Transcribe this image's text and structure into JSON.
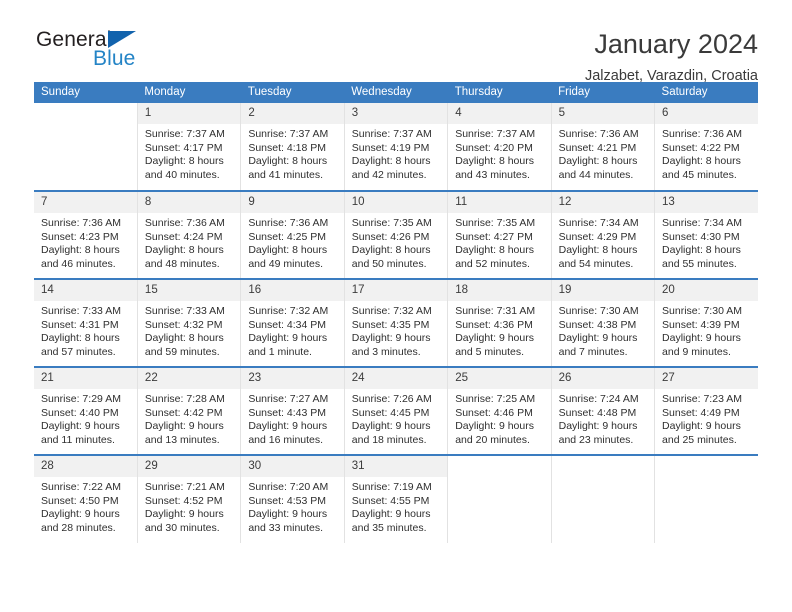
{
  "logo": {
    "text_top": "General",
    "text_bottom": "Blue",
    "triangle_color": "#1263ad",
    "blue_color": "#2484c6"
  },
  "header": {
    "title": "January 2024",
    "subtitle": "Jalzabet, Varazdin, Croatia"
  },
  "calendar": {
    "header_bg": "#3a7cc0",
    "daynum_bg": "#f1f1f1",
    "weekday_headers": [
      "Sunday",
      "Monday",
      "Tuesday",
      "Wednesday",
      "Thursday",
      "Friday",
      "Saturday"
    ],
    "weeks": [
      [
        {
          "day": "",
          "lines": []
        },
        {
          "day": "1",
          "lines": [
            "Sunrise: 7:37 AM",
            "Sunset: 4:17 PM",
            "Daylight: 8 hours",
            "and 40 minutes."
          ]
        },
        {
          "day": "2",
          "lines": [
            "Sunrise: 7:37 AM",
            "Sunset: 4:18 PM",
            "Daylight: 8 hours",
            "and 41 minutes."
          ]
        },
        {
          "day": "3",
          "lines": [
            "Sunrise: 7:37 AM",
            "Sunset: 4:19 PM",
            "Daylight: 8 hours",
            "and 42 minutes."
          ]
        },
        {
          "day": "4",
          "lines": [
            "Sunrise: 7:37 AM",
            "Sunset: 4:20 PM",
            "Daylight: 8 hours",
            "and 43 minutes."
          ]
        },
        {
          "day": "5",
          "lines": [
            "Sunrise: 7:36 AM",
            "Sunset: 4:21 PM",
            "Daylight: 8 hours",
            "and 44 minutes."
          ]
        },
        {
          "day": "6",
          "lines": [
            "Sunrise: 7:36 AM",
            "Sunset: 4:22 PM",
            "Daylight: 8 hours",
            "and 45 minutes."
          ]
        }
      ],
      [
        {
          "day": "7",
          "lines": [
            "Sunrise: 7:36 AM",
            "Sunset: 4:23 PM",
            "Daylight: 8 hours",
            "and 46 minutes."
          ]
        },
        {
          "day": "8",
          "lines": [
            "Sunrise: 7:36 AM",
            "Sunset: 4:24 PM",
            "Daylight: 8 hours",
            "and 48 minutes."
          ]
        },
        {
          "day": "9",
          "lines": [
            "Sunrise: 7:36 AM",
            "Sunset: 4:25 PM",
            "Daylight: 8 hours",
            "and 49 minutes."
          ]
        },
        {
          "day": "10",
          "lines": [
            "Sunrise: 7:35 AM",
            "Sunset: 4:26 PM",
            "Daylight: 8 hours",
            "and 50 minutes."
          ]
        },
        {
          "day": "11",
          "lines": [
            "Sunrise: 7:35 AM",
            "Sunset: 4:27 PM",
            "Daylight: 8 hours",
            "and 52 minutes."
          ]
        },
        {
          "day": "12",
          "lines": [
            "Sunrise: 7:34 AM",
            "Sunset: 4:29 PM",
            "Daylight: 8 hours",
            "and 54 minutes."
          ]
        },
        {
          "day": "13",
          "lines": [
            "Sunrise: 7:34 AM",
            "Sunset: 4:30 PM",
            "Daylight: 8 hours",
            "and 55 minutes."
          ]
        }
      ],
      [
        {
          "day": "14",
          "lines": [
            "Sunrise: 7:33 AM",
            "Sunset: 4:31 PM",
            "Daylight: 8 hours",
            "and 57 minutes."
          ]
        },
        {
          "day": "15",
          "lines": [
            "Sunrise: 7:33 AM",
            "Sunset: 4:32 PM",
            "Daylight: 8 hours",
            "and 59 minutes."
          ]
        },
        {
          "day": "16",
          "lines": [
            "Sunrise: 7:32 AM",
            "Sunset: 4:34 PM",
            "Daylight: 9 hours",
            "and 1 minute."
          ]
        },
        {
          "day": "17",
          "lines": [
            "Sunrise: 7:32 AM",
            "Sunset: 4:35 PM",
            "Daylight: 9 hours",
            "and 3 minutes."
          ]
        },
        {
          "day": "18",
          "lines": [
            "Sunrise: 7:31 AM",
            "Sunset: 4:36 PM",
            "Daylight: 9 hours",
            "and 5 minutes."
          ]
        },
        {
          "day": "19",
          "lines": [
            "Sunrise: 7:30 AM",
            "Sunset: 4:38 PM",
            "Daylight: 9 hours",
            "and 7 minutes."
          ]
        },
        {
          "day": "20",
          "lines": [
            "Sunrise: 7:30 AM",
            "Sunset: 4:39 PM",
            "Daylight: 9 hours",
            "and 9 minutes."
          ]
        }
      ],
      [
        {
          "day": "21",
          "lines": [
            "Sunrise: 7:29 AM",
            "Sunset: 4:40 PM",
            "Daylight: 9 hours",
            "and 11 minutes."
          ]
        },
        {
          "day": "22",
          "lines": [
            "Sunrise: 7:28 AM",
            "Sunset: 4:42 PM",
            "Daylight: 9 hours",
            "and 13 minutes."
          ]
        },
        {
          "day": "23",
          "lines": [
            "Sunrise: 7:27 AM",
            "Sunset: 4:43 PM",
            "Daylight: 9 hours",
            "and 16 minutes."
          ]
        },
        {
          "day": "24",
          "lines": [
            "Sunrise: 7:26 AM",
            "Sunset: 4:45 PM",
            "Daylight: 9 hours",
            "and 18 minutes."
          ]
        },
        {
          "day": "25",
          "lines": [
            "Sunrise: 7:25 AM",
            "Sunset: 4:46 PM",
            "Daylight: 9 hours",
            "and 20 minutes."
          ]
        },
        {
          "day": "26",
          "lines": [
            "Sunrise: 7:24 AM",
            "Sunset: 4:48 PM",
            "Daylight: 9 hours",
            "and 23 minutes."
          ]
        },
        {
          "day": "27",
          "lines": [
            "Sunrise: 7:23 AM",
            "Sunset: 4:49 PM",
            "Daylight: 9 hours",
            "and 25 minutes."
          ]
        }
      ],
      [
        {
          "day": "28",
          "lines": [
            "Sunrise: 7:22 AM",
            "Sunset: 4:50 PM",
            "Daylight: 9 hours",
            "and 28 minutes."
          ]
        },
        {
          "day": "29",
          "lines": [
            "Sunrise: 7:21 AM",
            "Sunset: 4:52 PM",
            "Daylight: 9 hours",
            "and 30 minutes."
          ]
        },
        {
          "day": "30",
          "lines": [
            "Sunrise: 7:20 AM",
            "Sunset: 4:53 PM",
            "Daylight: 9 hours",
            "and 33 minutes."
          ]
        },
        {
          "day": "31",
          "lines": [
            "Sunrise: 7:19 AM",
            "Sunset: 4:55 PM",
            "Daylight: 9 hours",
            "and 35 minutes."
          ]
        },
        {
          "day": "",
          "lines": []
        },
        {
          "day": "",
          "lines": []
        },
        {
          "day": "",
          "lines": []
        }
      ]
    ]
  }
}
